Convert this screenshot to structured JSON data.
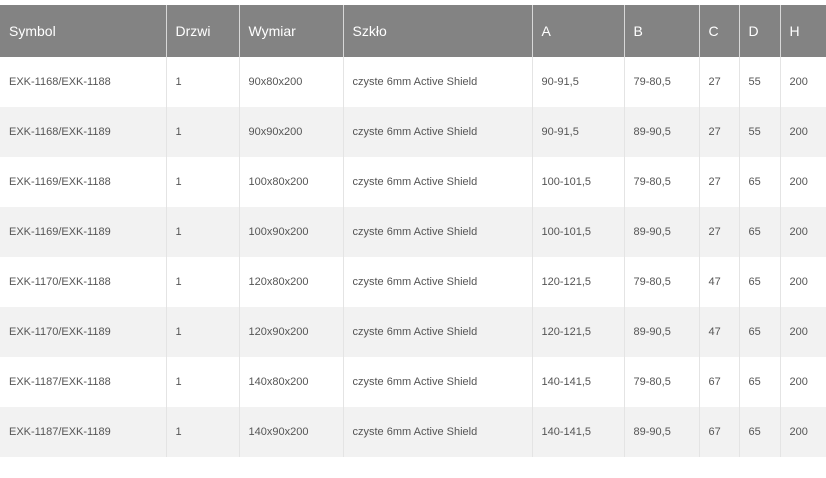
{
  "table": {
    "headers": [
      "Symbol",
      "Drzwi",
      "Wymiar",
      "Szkło",
      "A",
      "B",
      "C",
      "D",
      "H"
    ],
    "rows": [
      [
        "EXK-1168/EXK-1188",
        "1",
        "90x80x200",
        "czyste 6mm Active Shield",
        "90-91,5",
        "79-80,5",
        "27",
        "55",
        "200"
      ],
      [
        "EXK-1168/EXK-1189",
        "1",
        "90x90x200",
        "czyste 6mm Active Shield",
        "90-91,5",
        "89-90,5",
        "27",
        "55",
        "200"
      ],
      [
        "EXK-1169/EXK-1188",
        "1",
        "100x80x200",
        "czyste 6mm Active Shield",
        "100-101,5",
        "79-80,5",
        "27",
        "65",
        "200"
      ],
      [
        "EXK-1169/EXK-1189",
        "1",
        "100x90x200",
        "czyste 6mm Active Shield",
        "100-101,5",
        "89-90,5",
        "27",
        "65",
        "200"
      ],
      [
        "EXK-1170/EXK-1188",
        "1",
        "120x80x200",
        "czyste 6mm Active Shield",
        "120-121,5",
        "79-80,5",
        "47",
        "65",
        "200"
      ],
      [
        "EXK-1170/EXK-1189",
        "1",
        "120x90x200",
        "czyste 6mm Active Shield",
        "120-121,5",
        "89-90,5",
        "47",
        "65",
        "200"
      ],
      [
        "EXK-1187/EXK-1188",
        "1",
        "140x80x200",
        "czyste 6mm Active Shield",
        "140-141,5",
        "79-80,5",
        "67",
        "65",
        "200"
      ],
      [
        "EXK-1187/EXK-1189",
        "1",
        "140x90x200",
        "czyste 6mm Active Shield",
        "140-141,5",
        "89-90,5",
        "67",
        "65",
        "200"
      ]
    ]
  },
  "colors": {
    "header_bg": "#838383",
    "header_text": "#ffffff",
    "row_alt_bg": "#f2f2f2",
    "cell_text": "#555555"
  }
}
